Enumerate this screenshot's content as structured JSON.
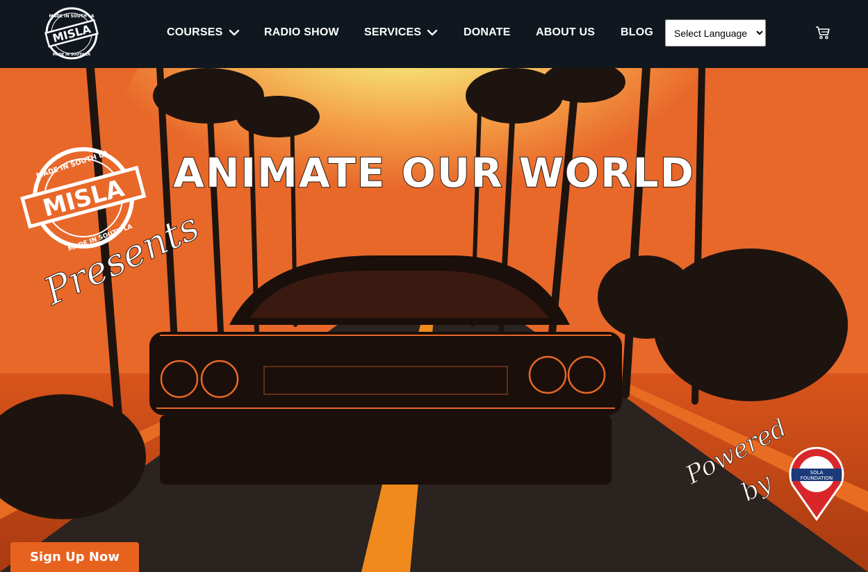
{
  "header": {
    "logo": {
      "text_top": "MADE IN SOUTH LA",
      "text_main": "MISLA",
      "text_bottom": "MADE IN SOUTH LA"
    },
    "nav": [
      {
        "label": "COURSES",
        "has_dropdown": true
      },
      {
        "label": "RADIO SHOW",
        "has_dropdown": false
      },
      {
        "label": "SERVICES",
        "has_dropdown": true
      },
      {
        "label": "DONATE",
        "has_dropdown": false
      },
      {
        "label": "ABOUT US",
        "has_dropdown": false
      },
      {
        "label": "BLOG",
        "has_dropdown": false
      }
    ],
    "language_select": {
      "selected": "Select Language"
    },
    "cart_icon": "cart-icon"
  },
  "hero": {
    "headline": "ANIMATE OUR WORLD",
    "presents_logo": {
      "text_top": "MADE IN SOUTH LA",
      "text_main": "MISLA",
      "text_bottom": "MADE IN SOUTH LA",
      "script": "Presents"
    },
    "powered_by": {
      "script_line1": "Powered",
      "script_line2": "by",
      "badge_line1": "SOLA",
      "badge_line2": "FOUNDATION"
    }
  },
  "cta": {
    "signup_label": "Sign Up Now"
  },
  "colors": {
    "header_bg": "#11171f",
    "accent": "#e8621f",
    "sky": "#f0e68c",
    "orange": "#e8682a"
  }
}
